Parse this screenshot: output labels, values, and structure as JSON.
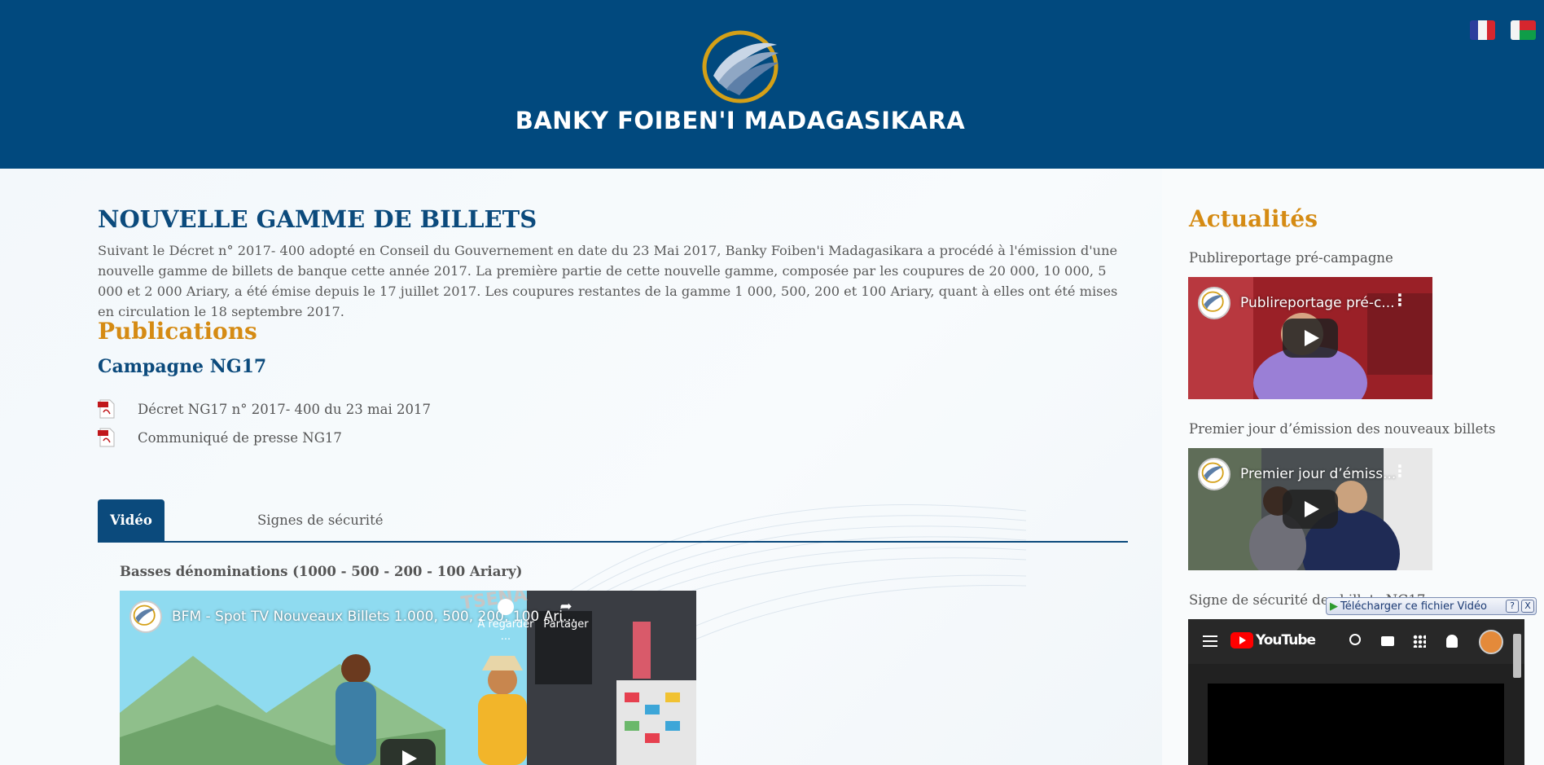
{
  "header": {
    "brand": "BANKY FOIBEN'I MADAGASIKARA",
    "languages": [
      {
        "name": "Français",
        "icon": "flag-france-icon"
      },
      {
        "name": "Malagasy",
        "icon": "flag-madagascar-icon"
      }
    ]
  },
  "main": {
    "title": "NOUVELLE GAMME DE BILLETS",
    "intro": "Suivant le Décret n° 2017- 400 adopté en Conseil du Gouvernement en date du 23 Mai 2017, Banky Foiben'i Madagasikara a procédé à l'émission d'une nouvelle gamme de billets de banque cette année 2017. La première partie de cette nouvelle gamme, composée par les coupures de 20 000, 10 000, 5 000 et 2 000 Ariary, a été émise depuis le 17 juillet 2017. Les coupures restantes de la gamme 1 000, 500, 200 et 100 Ariary, quant à elles ont été mises en circulation le 18 septembre 2017.",
    "publications_title": "Publications",
    "campaign_title": "Campagne NG17",
    "documents": [
      {
        "label": "Décret NG17 n° 2017- 400 du 23 mai 2017"
      },
      {
        "label": "Communiqué de presse NG17"
      }
    ],
    "tabs": [
      {
        "label": "Vidéo",
        "active": true
      },
      {
        "label": "Signes de sécurité",
        "active": false
      }
    ],
    "video_caption": "Basses dénominations (1000 - 500 - 200 - 100 Ariary)",
    "video": {
      "title": "BFM - Spot TV Nouveaux Billets 1.000, 500, 200, 100 Ari...",
      "watch_later": "À regarder ...",
      "share": "Partager",
      "sign_text": "TSENA"
    }
  },
  "sidebar": {
    "title": "Actualités",
    "items": [
      {
        "caption": "Publireportage pré-campagne",
        "video_title": "Publireportage pré-c..."
      },
      {
        "caption": "Premier jour d’émission des nouveaux billets",
        "video_title": "Premier jour d’émiss..."
      },
      {
        "caption": "Signe de sécurité des billets NG17"
      }
    ],
    "youtube_logo": "YouTube"
  },
  "download_bar": {
    "label": "Télécharger ce fichier Vidéo",
    "help": "?",
    "close": "X"
  },
  "colors": {
    "header_bg": "#01497e",
    "title_blue": "#0b4a7c",
    "accent_orange": "#d58b14"
  }
}
